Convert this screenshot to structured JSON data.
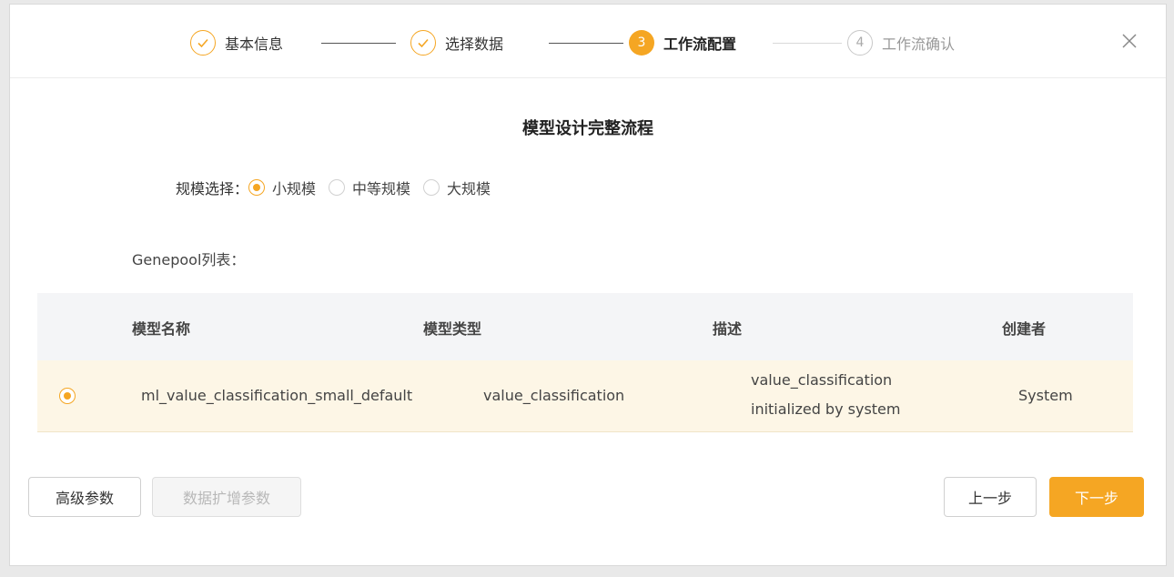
{
  "steps": [
    {
      "label": "基本信息",
      "state": "done",
      "num": ""
    },
    {
      "label": "选择数据",
      "state": "done",
      "num": ""
    },
    {
      "label": "工作流配置",
      "state": "active",
      "num": "3"
    },
    {
      "label": "工作流确认",
      "state": "todo",
      "num": "4"
    }
  ],
  "close_icon": "close-icon",
  "title": "模型设计完整流程",
  "scale": {
    "label": "规模选择：",
    "options": [
      "小规模",
      "中等规模",
      "大规模"
    ],
    "selected": "小规模"
  },
  "genepool": {
    "label": "Genepool列表："
  },
  "table": {
    "headers": [
      "模型名称",
      "模型类型",
      "描述",
      "创建者"
    ],
    "rows": [
      {
        "selected": true,
        "name": "ml_value_classification_small_default",
        "type": "value_classification",
        "desc_line1": "value_classification",
        "desc_line2": "initialized by system",
        "creator": "System"
      }
    ]
  },
  "buttons": {
    "advanced": "高级参数",
    "augment": "数据扩增参数",
    "prev": "上一步",
    "next": "下一步"
  },
  "colors": {
    "accent": "#f5a623",
    "row_highlight": "#fdf6e6",
    "header_bg": "#f4f5f7"
  }
}
